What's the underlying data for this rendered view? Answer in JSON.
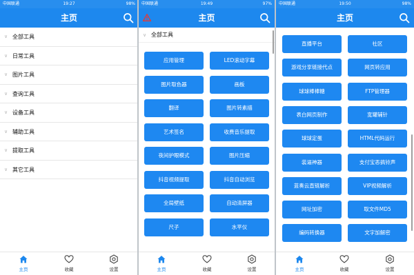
{
  "colors": {
    "primary": "#1d88ee",
    "button": "#1e88f1",
    "warning": "#e53935"
  },
  "panel1": {
    "status": {
      "left": "中国联通",
      "time": "19:27",
      "right": "98%"
    },
    "title": "主页",
    "menu": [
      "全部工具",
      "日常工具",
      "图片工具",
      "查询工具",
      "设备工具",
      "辅助工具",
      "提取工具",
      "其它工具"
    ],
    "tabs": [
      {
        "label": "主页",
        "icon": "home-icon"
      },
      {
        "label": "收藏",
        "icon": "heart-icon"
      },
      {
        "label": "设置",
        "icon": "settings-icon"
      }
    ]
  },
  "panel2": {
    "status": {
      "left": "中国联通",
      "time": "19:49",
      "right": "97%"
    },
    "title": "主页",
    "section": "全部工具",
    "buttons": [
      "应用管理",
      "LED滚动字幕",
      "图片取色器",
      "画板",
      "翻译",
      "图片转素描",
      "艺术签名",
      "收费音乐提取",
      "夜间护眼模式",
      "图片压缩",
      "抖音视频提取",
      "抖音自动浏览",
      "全局壁纸",
      "自动清屏器",
      "尺子",
      "水平仪"
    ],
    "tabs": [
      {
        "label": "主页",
        "icon": "home-icon"
      },
      {
        "label": "收藏",
        "icon": "heart-icon"
      },
      {
        "label": "设置",
        "icon": "settings-icon"
      }
    ]
  },
  "panel3": {
    "status": {
      "left": "中国联通",
      "time": "19:50",
      "right": "98%"
    },
    "title": "主页",
    "buttons": [
      "直播平台",
      "社区",
      "游戏分享链接代点",
      "网页转应用",
      "球球棒棒糖",
      "FTP管理器",
      "表白网页制作",
      "宽罐辅针",
      "球球定蛋",
      "HTML代码运行",
      "装逼神器",
      "支付宝恶搞铃声",
      "蓝奏云直链解析",
      "VIP视频解析",
      "网址加密",
      "取文件MD5",
      "编码转换器",
      "文字加解密"
    ],
    "tabs": [
      {
        "label": "主页",
        "icon": "home-icon"
      },
      {
        "label": "收藏",
        "icon": "heart-icon"
      },
      {
        "label": "设置",
        "icon": "settings-icon"
      }
    ]
  }
}
